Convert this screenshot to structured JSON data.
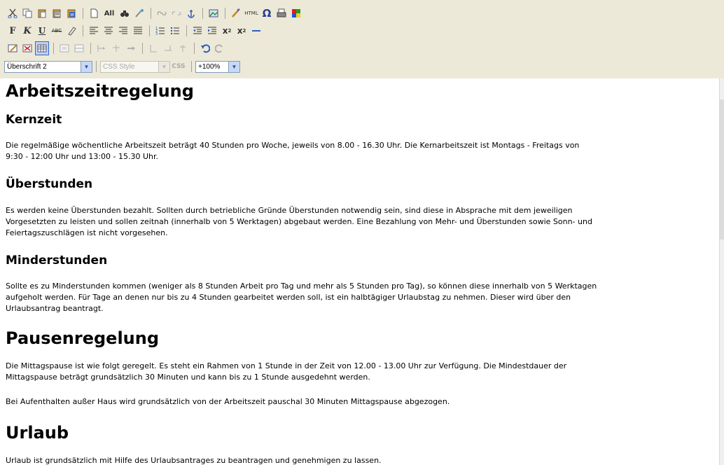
{
  "toolbar": {
    "row1": [
      "scissors-icon",
      "copy-icon",
      "paste-icon",
      "paste-text-icon",
      "paste-word-icon",
      "new-document-icon",
      "select-all-icon",
      "find-replace-icon",
      "clean-icon",
      "link-icon",
      "unlink-icon",
      "anchor-icon",
      "image-icon",
      "spellcheck-icon",
      "html-icon",
      "special-char-icon",
      "print-icon",
      "color-icon"
    ],
    "row2": [
      "bold-icon",
      "italic-icon",
      "underline-icon",
      "strikethrough-icon",
      "remove-format-icon",
      "align-left-icon",
      "align-center-icon",
      "align-right-icon",
      "align-justify-icon",
      "ordered-list-icon",
      "unordered-list-icon",
      "outdent-icon",
      "indent-icon",
      "superscript-icon",
      "subscript-icon",
      "horizontal-rule-icon"
    ],
    "row3": [
      "edit-table-icon",
      "delete-table-icon",
      "insert-table-icon",
      "cell-props-icon",
      "row-props-icon",
      "insert-row-icon",
      "delete-row-icon",
      "insert-col-icon",
      "insert-col-right-icon",
      "merge-cells-icon",
      "split-cell-icon",
      "undo-icon",
      "redo-icon"
    ],
    "heading_select": "Überschrift 2",
    "css_select": "CSS Style",
    "css_label": "CSS",
    "zoom_select": "+100%"
  },
  "document": {
    "h1_arbeitszeit": "Arbeitszeitregelung",
    "h2_kernzeit": "Kernzeit",
    "p_kernzeit_1": "Die regelmäßige wöchentliche Arbeitszeit beträgt 40 Stunden pro Woche, jeweils von 8.00 - 16.30 Uhr. Die Kernarbeitszeit ist Montags - Freitags von",
    "p_kernzeit_2": "9:30 - 12:00 Uhr und 13:00 - 15.30 Uhr.",
    "h2_ueberstunden": "Überstunden",
    "p_ueber_1": "Es werden keine Überstunden bezahlt. Sollten durch betriebliche Gründe Überstunden notwendig sein, sind diese in Absprache mit dem jeweiligen",
    "p_ueber_2": "Vorgesetzten zu leisten und sollen zeitnah (innerhalb von 5 Werktagen) abgebaut werden. Eine Bezahlung von Mehr- und Überstunden sowie Sonn- und",
    "p_ueber_3": "Feiertagszuschlägen ist nicht vorgesehen.",
    "h2_minder": "Minderstunden",
    "p_minder_1": "Sollte es zu Minderstunden kommen (weniger als 8 Stunden Arbeit pro Tag und mehr als 5 Stunden pro Tag), so können diese innerhalb von 5 Werktagen",
    "p_minder_2": "aufgeholt werden. Für Tage an denen nur bis zu 4 Stunden gearbeitet werden soll, ist ein halbtägiger Urlaubstag zu nehmen. Dieser wird über den",
    "p_minder_3": "Urlaubsantrag beantragt.",
    "h1_pause": "Pausenregelung",
    "p_pause_1": "Die Mittagspause ist wie folgt geregelt. Es steht ein Rahmen von 1 Stunde in der Zeit von 12.00 - 13.00 Uhr zur Verfügung. Die Mindestdauer der",
    "p_pause_2": "Mittagspause beträgt grundsätzlich 30 Minuten und kann bis zu 1 Stunde ausgedehnt werden.",
    "p_pause_3": "Bei Aufenthalten außer Haus wird grundsätzlich von der Arbeitszeit pauschal 30 Minuten Mittagspause abgezogen.",
    "h1_urlaub": "Urlaub",
    "p_urlaub_1": "Urlaub ist grundsätzlich mit Hilfe des Urlaubsantrages zu beantragen und genehmigen zu lassen."
  }
}
